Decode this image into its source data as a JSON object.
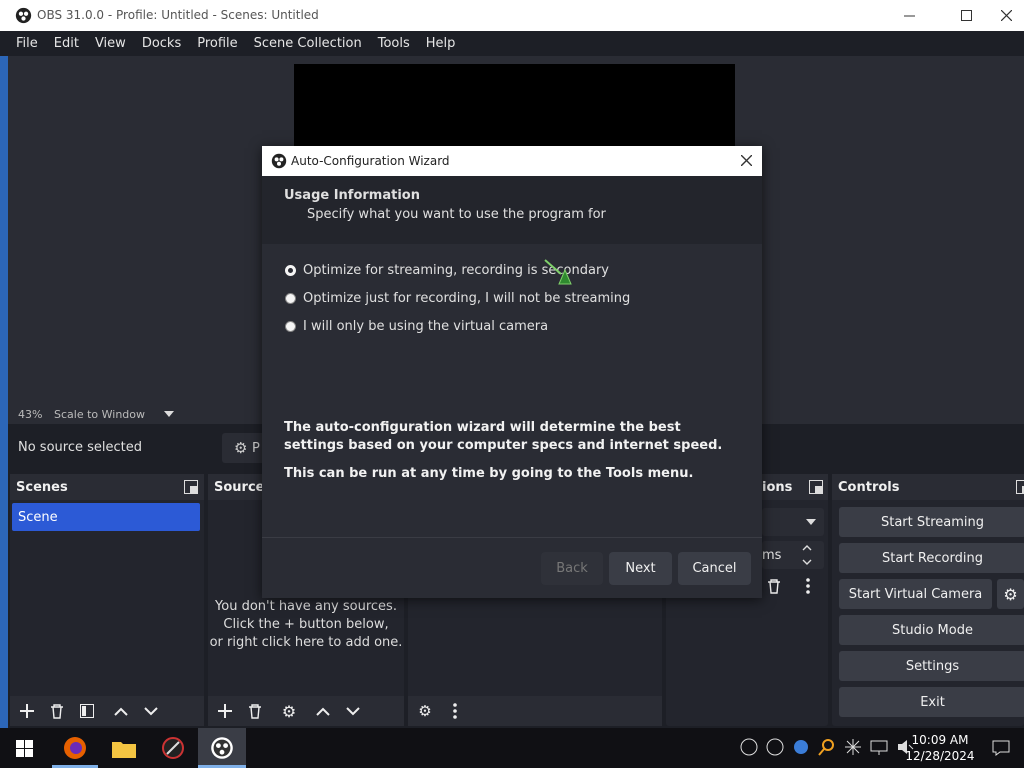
{
  "window": {
    "title": "OBS 31.0.0 - Profile: Untitled - Scenes: Untitled"
  },
  "menu": [
    "File",
    "Edit",
    "View",
    "Docks",
    "Profile",
    "Scene Collection",
    "Tools",
    "Help"
  ],
  "preview": {
    "zoom": "43%",
    "scale_mode": "Scale to Window"
  },
  "source_bar": {
    "status": "No source selected",
    "properties_label": "P"
  },
  "scenes": {
    "title": "Scenes",
    "items": [
      "Scene"
    ]
  },
  "sources": {
    "title": "Source",
    "empty_text": [
      "You don't have any sources.",
      "Click the + button below,",
      "or right click here to add one."
    ]
  },
  "transitions": {
    "title": "ions",
    "duration_label": "ms"
  },
  "controls": {
    "title": "Controls",
    "start_streaming": "Start Streaming",
    "start_recording": "Start Recording",
    "start_virtual_camera": "Start Virtual Camera",
    "studio_mode": "Studio Mode",
    "settings": "Settings",
    "exit": "Exit"
  },
  "wizard": {
    "title": "Auto-Configuration Wizard",
    "heading": "Usage Information",
    "subheading": "Specify what you want to use the program for",
    "options": [
      "Optimize for streaming, recording is secondary",
      "Optimize just for recording, I will not be streaming",
      "I will only be using the virtual camera"
    ],
    "selected_option": 0,
    "info1": "The auto-configuration wizard will determine the best settings based on your computer specs and internet speed.",
    "info2": "This can be run at any time by going to the Tools menu.",
    "back": "Back",
    "next": "Next",
    "cancel": "Cancel"
  },
  "taskbar": {
    "time": "10:09 AM",
    "date": "12/28/2024"
  },
  "colors": {
    "accent": "#2c5ad6",
    "background": "#1d1f26",
    "panel": "#2a2c34",
    "button": "#3a3d46"
  }
}
